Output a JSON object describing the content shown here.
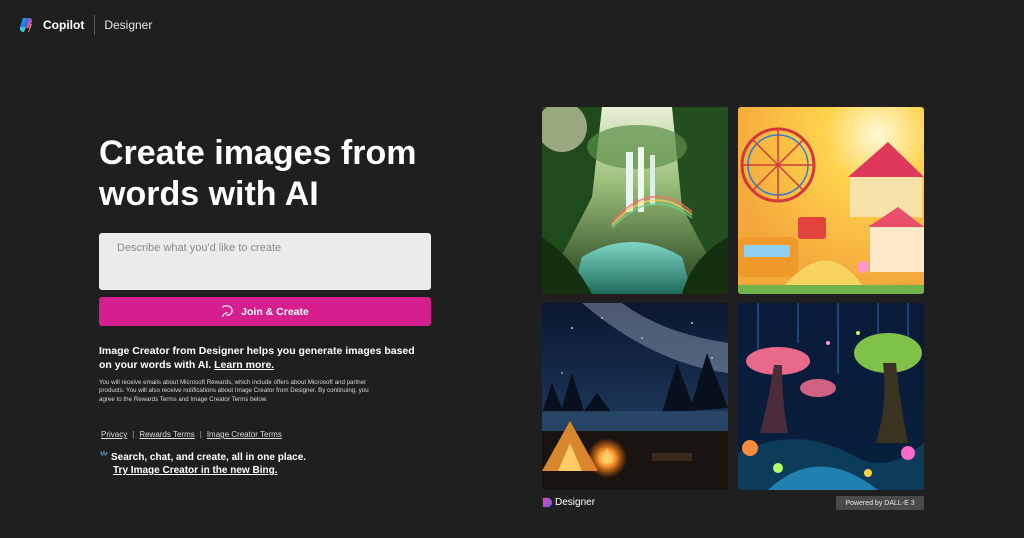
{
  "header": {
    "brand": "Copilot",
    "product": "Designer",
    "logo_icon": "copilot-logo-icon"
  },
  "hero": {
    "title": "Create images from words with AI"
  },
  "prompt": {
    "placeholder": "Describe what you'd like to create",
    "value": ""
  },
  "join_button": {
    "label": "Join & Create",
    "icon": "image-sparkle-icon",
    "color": "#d61f8e"
  },
  "intro": {
    "text": "Image Creator from Designer helps you generate images based on your words with AI. ",
    "learn_more": "Learn more."
  },
  "fineprint": "You will receive emails about Microsoft Rewards, which include offers about Microsoft and partner products. You will also receive notifications about Image Creator from Designer. By continuing, you agree to the Rewards Terms and Image Creator Terms below.",
  "links": {
    "privacy": "Privacy",
    "rewards_terms": "Rewards Terms",
    "image_creator_terms": "Image Creator Terms",
    "separator": "|"
  },
  "bing": {
    "line1": "Search, chat, and create, all in one place.",
    "line2": "Try Image Creator in the new Bing.",
    "icon": "sparkle-icon"
  },
  "gallery": {
    "images": [
      {
        "name": "waterfall-rainforest-image"
      },
      {
        "name": "carnival-fairground-image"
      },
      {
        "name": "campfire-milky-way-image"
      },
      {
        "name": "glowing-fantasy-forest-image"
      }
    ],
    "designer_label": "Designer",
    "powered_by": "Powered by DALL-E 3"
  },
  "colors": {
    "background": "#1f1f1f",
    "accent": "#d61f8e"
  }
}
